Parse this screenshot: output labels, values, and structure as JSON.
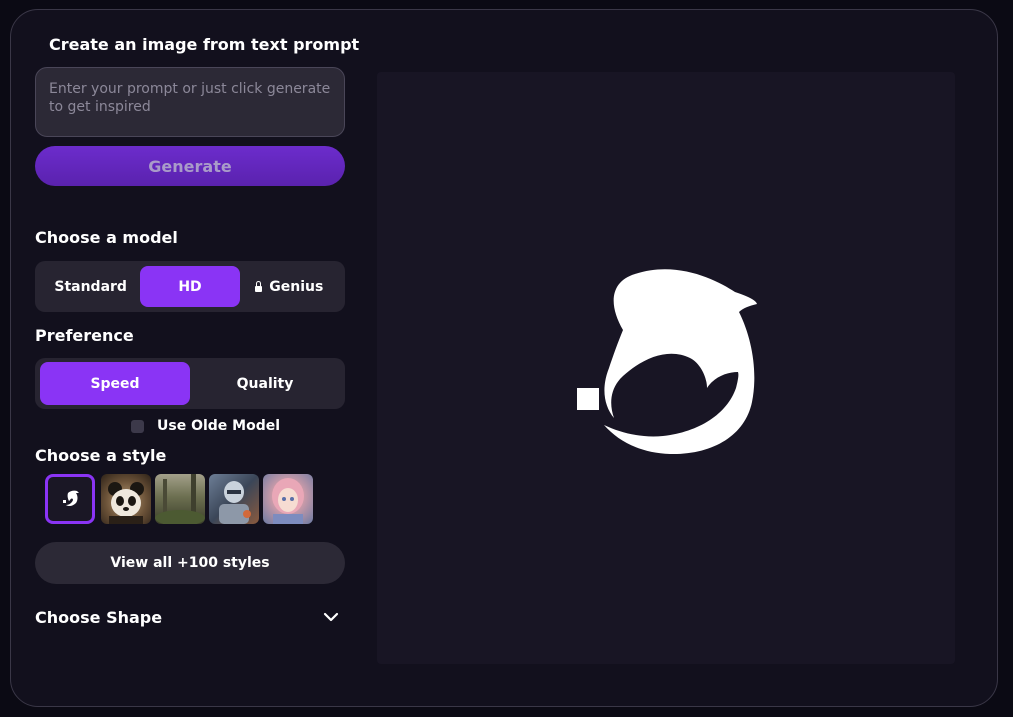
{
  "panel": {
    "title": "Create an image from text prompt",
    "prompt_placeholder": "Enter your prompt or just click generate to get inspired",
    "generate_label": "Generate"
  },
  "model": {
    "label": "Choose a model",
    "options": [
      "Standard",
      "HD",
      "Genius"
    ],
    "selected": "HD"
  },
  "preference": {
    "label": "Preference",
    "options": [
      "Speed",
      "Quality"
    ],
    "selected": "Speed",
    "checkbox_label": "Use Olde Model",
    "checkbox_checked": false
  },
  "style": {
    "label": "Choose a style",
    "thumbnails": [
      "dolphin-logo",
      "panda",
      "forest",
      "robot",
      "anime-girl"
    ],
    "selected": "dolphin-logo",
    "view_all_label": "View all +100 styles"
  },
  "shape": {
    "label": "Choose Shape"
  },
  "colors": {
    "accent": "#8a34f5",
    "background": "#12101d",
    "preview": "#181524"
  }
}
